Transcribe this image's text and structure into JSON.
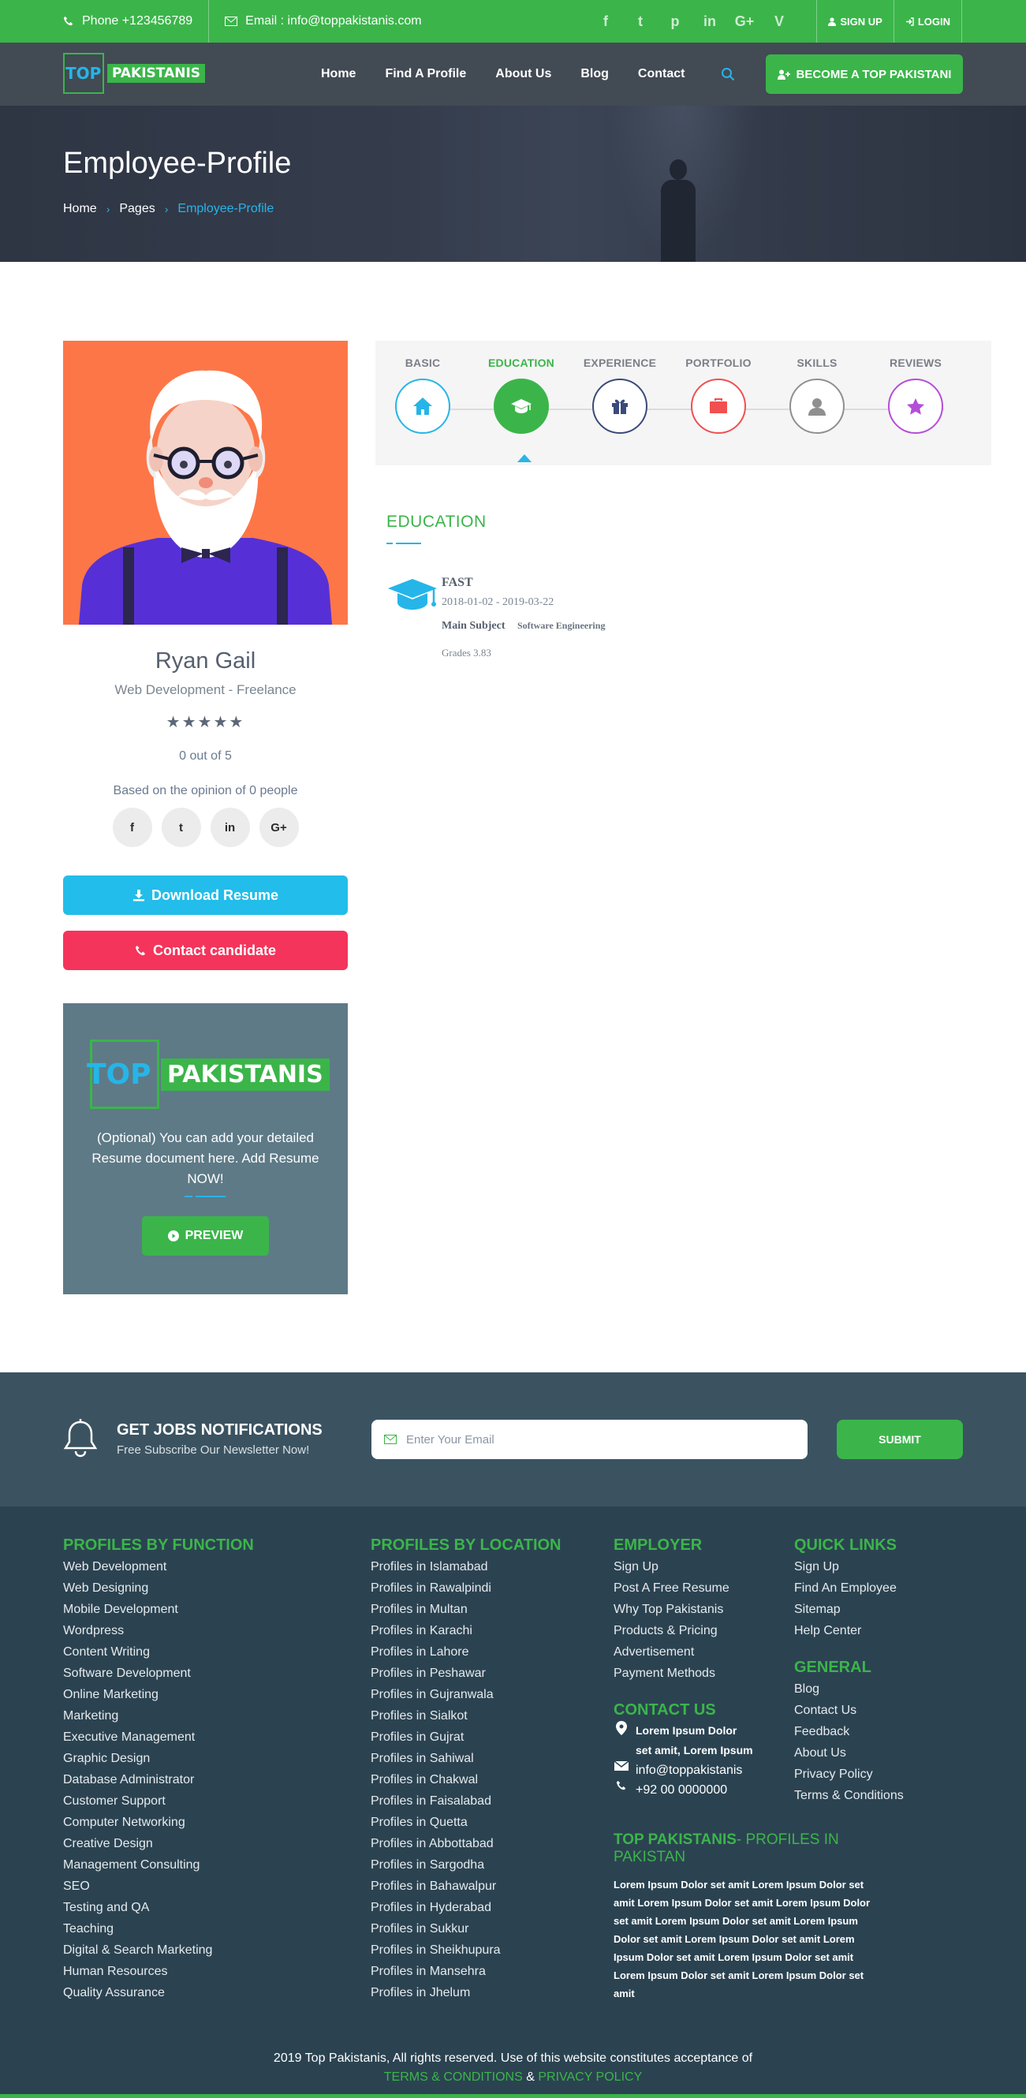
{
  "topbar": {
    "phone": "Phone  +123456789",
    "email": "Email : info@toppakistanis.com",
    "social": [
      "f",
      "t",
      "p",
      "in",
      "G+",
      "V"
    ],
    "signup": "SIGN UP",
    "login": "LOGIN"
  },
  "nav": {
    "logo_top": "TOP",
    "logo_pak": "PAKISTANIS",
    "items": [
      "Home",
      "Find A Profile",
      "About Us",
      "Blog",
      "Contact"
    ],
    "cta": "BECOME A TOP PAKISTANI"
  },
  "header": {
    "title": "Employee-Profile",
    "crumbs": [
      "Home",
      "Pages",
      "Employee-Profile"
    ]
  },
  "profile": {
    "name": "Ryan Gail",
    "role": "Web Development - Freelance",
    "stars": "★★★★★",
    "rating": "0 out of 5",
    "opinion": "Based on the opinion of 0 people",
    "share": [
      "f",
      "t",
      "in",
      "G+"
    ],
    "download": "Download Resume",
    "contact": "Contact candidate"
  },
  "resume_card": {
    "logo_top": "TOP",
    "logo_pak": "PAKISTANIS",
    "text": "(Optional) You can add your detailed Resume document here. Add Resume NOW!",
    "button": "PREVIEW"
  },
  "tabs": [
    {
      "label": "BASIC",
      "icon": "home-icon",
      "color": "#26b5e8"
    },
    {
      "label": "EDUCATION",
      "icon": "graduation-cap-icon",
      "color": "#3bb54a"
    },
    {
      "label": "EXPERIENCE",
      "icon": "gift-icon",
      "color": "#3a4a7a"
    },
    {
      "label": "PORTFOLIO",
      "icon": "briefcase-icon",
      "color": "#f05050"
    },
    {
      "label": "SKILLS",
      "icon": "user-icon",
      "color": "#8f8f8f"
    },
    {
      "label": "REVIEWS",
      "icon": "star-icon",
      "color": "#b44ed9"
    }
  ],
  "education": {
    "heading": "EDUCATION",
    "school": "FAST",
    "dates": "2018-01-02 - 2019-03-22",
    "subject_label": "Main Subject",
    "subject": "Software Engineering",
    "grades": "Grades 3.83"
  },
  "newsletter": {
    "title": "GET JOBS NOTIFICATIONS",
    "subtitle": "Free Subscribe Our Newsletter Now!",
    "placeholder": "Enter Your Email",
    "submit": "SUBMIT"
  },
  "footer": {
    "by_function": {
      "title": "PROFILES BY FUNCTION",
      "items": [
        "Web Development",
        "Web Designing",
        "Mobile Development",
        "Wordpress",
        "Content Writing",
        "Software Development",
        "Online Marketing",
        "Marketing",
        "Executive Management",
        "Graphic Design",
        "Database Administrator",
        "Customer Support",
        "Computer Networking",
        "Creative Design",
        "Management Consulting",
        "SEO",
        "Testing and QA",
        "Teaching",
        "Digital & Search Marketing",
        "Human Resources",
        "Quality Assurance"
      ]
    },
    "by_location": {
      "title": "PROFILES BY LOCATION",
      "items": [
        "Profiles in Islamabad",
        "Profiles in Rawalpindi",
        "Profiles in Multan",
        "Profiles in Karachi",
        "Profiles in Lahore",
        "Profiles in Peshawar",
        "Profiles in Gujranwala",
        "Profiles in Sialkot",
        "Profiles in Gujrat",
        "Profiles in Sahiwal",
        "Profiles in Chakwal",
        "Profiles in Faisalabad",
        "Profiles in Quetta",
        "Profiles in Abbottabad",
        "Profiles in Sargodha",
        "Profiles in Bahawalpur",
        "Profiles in Hyderabad",
        "Profiles in Sukkur",
        "Profiles in Sheikhupura",
        "Profiles in Mansehra",
        "Profiles in Jhelum"
      ]
    },
    "employer": {
      "title": "EMPLOYER",
      "items": [
        "Sign Up",
        "Post A Free Resume",
        "Why Top Pakistanis",
        "Products & Pricing",
        "Advertisement",
        "Payment Methods"
      ]
    },
    "contact": {
      "title": "CONTACT US",
      "address": "Lorem Ipsum Dolor set amit, Lorem Ipsum",
      "email": "info@toppakistanis",
      "phone": "+92 00 0000000"
    },
    "quick_links": {
      "title": "QUICK LINKS",
      "items": [
        "Sign Up",
        "Find An Employee",
        "Sitemap",
        "Help Center"
      ]
    },
    "general": {
      "title": "GENERAL",
      "items": [
        "Blog",
        "Contact Us",
        "Feedback",
        "About Us",
        "Privacy Policy",
        "Terms & Conditions"
      ]
    },
    "about": {
      "title_main": "TOP PAKISTANIS",
      "title_rest": "- PROFILES IN PAKISTAN",
      "body": "Lorem Ipsum Dolor set amit Lorem Ipsum Dolor set amit Lorem Ipsum Dolor set amit Lorem Ipsum Dolor set amit Lorem Ipsum Dolor set amit Lorem Ipsum Dolor set amit Lorem Ipsum Dolor set amit Lorem Ipsum Dolor set amit Lorem Ipsum Dolor set amit Lorem Ipsum Dolor set amit Lorem Ipsum Dolor set amit"
    },
    "copyright": "2019 Top Pakistanis, All rights reserved. Use of this website constitutes acceptance of",
    "terms": "TERMS & CONDITIONS",
    "and": "&",
    "privacy": "PRIVACY POLICY"
  },
  "colors": {
    "brand_green": "#3bb54a",
    "accent_blue": "#26b5e8",
    "danger": "#f4345b",
    "nav_bg": "#424a54",
    "footer_bg": "#2b4351"
  }
}
